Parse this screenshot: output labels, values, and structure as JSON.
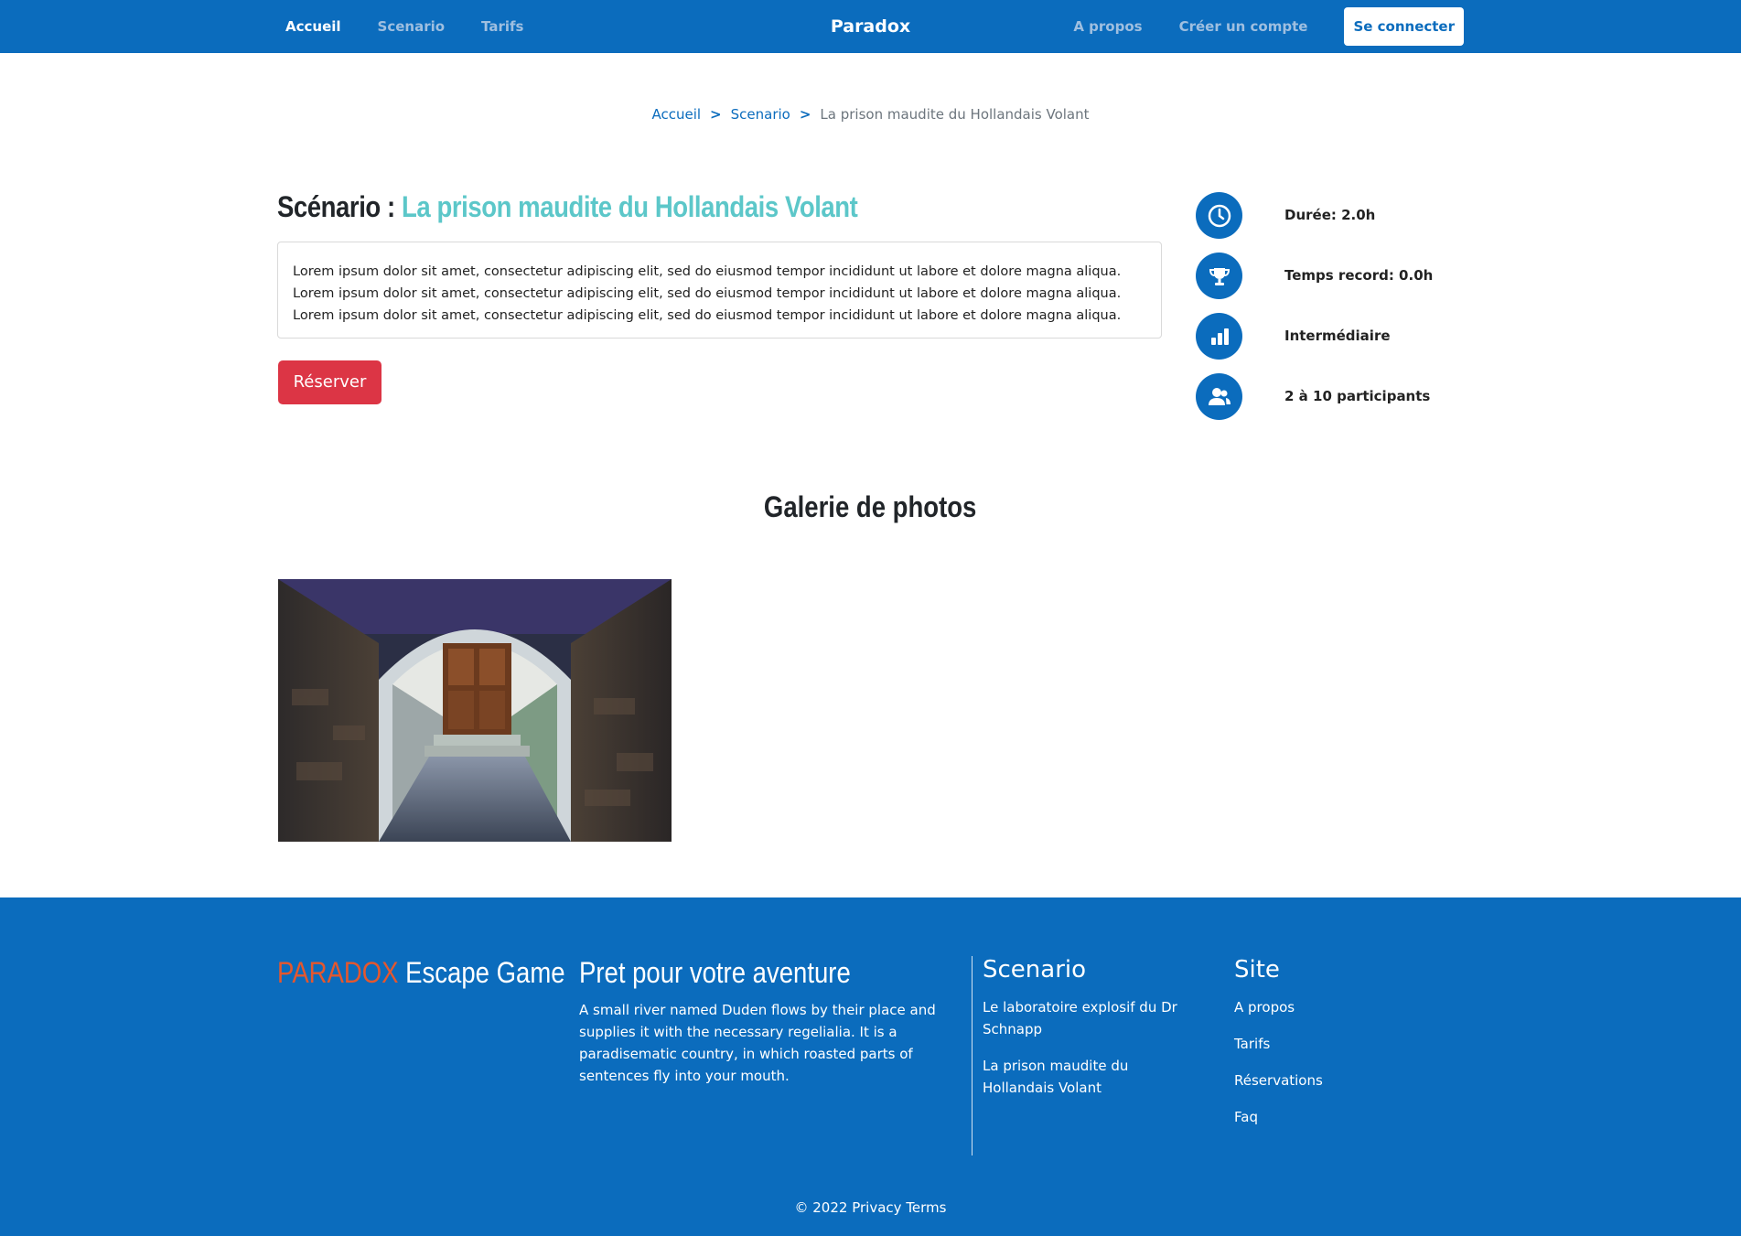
{
  "nav": {
    "left": [
      {
        "label": "Accueil",
        "active": true
      },
      {
        "label": "Scenario",
        "active": false
      },
      {
        "label": "Tarifs",
        "active": false
      }
    ],
    "brand": "Paradox",
    "right": {
      "about": "A propos",
      "register": "Créer un compte",
      "login": "Se connecter"
    }
  },
  "breadcrumb": {
    "home": "Accueil",
    "section": "Scenario",
    "separator": ">",
    "current": "La prison maudite du Hollandais Volant"
  },
  "scenario": {
    "prefix": "Scénario :",
    "name": "La prison maudite du Hollandais Volant",
    "description": "Lorem ipsum dolor sit amet, consectetur adipiscing elit, sed do eiusmod tempor incididunt ut labore et dolore magna aliqua. Lorem ipsum dolor sit amet, consectetur adipiscing elit, sed do eiusmod tempor incididunt ut labore et dolore magna aliqua. Lorem ipsum dolor sit amet, consectetur adipiscing elit, sed do eiusmod tempor incididunt ut labore et dolore magna aliqua.",
    "reserve_label": "Réserver",
    "info": [
      {
        "icon": "clock-icon",
        "text": "Durée: 2.0h"
      },
      {
        "icon": "trophy-icon",
        "text": "Temps record: 0.0h"
      },
      {
        "icon": "bar-chart-icon",
        "text": "Intermédiaire"
      },
      {
        "icon": "users-icon",
        "text": "2 à 10 participants"
      }
    ]
  },
  "gallery": {
    "title": "Galerie de photos"
  },
  "footer": {
    "brand_accent": "PARADOX",
    "brand_rest": "Escape Game",
    "about_title": "Pret pour votre aventure",
    "about_text": "A small river named Duden flows by their place and supplies it with the necessary regelialia. It is a paradisematic country, in which roasted parts of sentences fly into your mouth.",
    "scenario_title": "Scenario",
    "scenario_links": [
      "Le laboratoire explosif du Dr Schnapp",
      "La prison maudite du Hollandais Volant"
    ],
    "site_title": "Site",
    "site_links": [
      "A propos",
      "Tarifs",
      "Réservations",
      "Faq"
    ],
    "copyright": "© 2022",
    "privacy": "Privacy",
    "terms": "Terms"
  },
  "colors": {
    "primary": "#0b6cbd",
    "accent_teal": "#5cc7c9",
    "danger": "#dc3545",
    "brand_orange": "#e4572e"
  }
}
